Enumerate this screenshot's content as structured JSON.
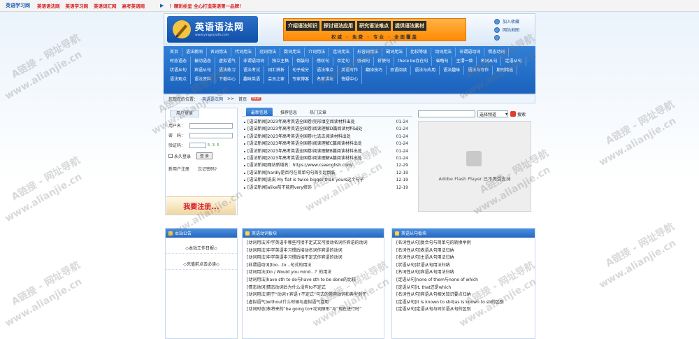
{
  "topbar": {
    "net": "英语学习网",
    "links": [
      "英语语法网",
      "英语学习网",
      "英语词汇网",
      "高考英语网"
    ],
    "promo": "！精彩纷呈 全心打造英语第一品牌！"
  },
  "header": {
    "logo_title": "英语语法网",
    "logo_sub": "www.yingyuyufa.com",
    "banner_tags": [
      "介绍语法知识",
      "探讨语法应用",
      "研究语法难点",
      "提供语法素材"
    ],
    "banner_sub": "权威 · 免费 · 专业 · 全面覆盖",
    "links": [
      "加入收藏",
      "网站地图"
    ]
  },
  "nav": {
    "items": [
      "首页",
      "语法新闻",
      "名词用法",
      "代词用法",
      "冠词用法",
      "数词用法",
      "介词用法",
      "连词用法",
      "形容词用法",
      "副词用法",
      "比较等级",
      "动词用法",
      "非谓语动词",
      "情态动词",
      "时态语态",
      "被动语态",
      "虚拟语气",
      "非谓语动词",
      "独立主格",
      "倒装句",
      "感叹句",
      "否定句",
      "强调句",
      "祈使句",
      "there be存在句",
      "省略句",
      "主谓一致",
      "名词从句",
      "定语从句",
      "状语从句",
      "宾语从句",
      "语法练习",
      "语法考试",
      "词汇辨析",
      "句子成分",
      "语法难点",
      "英语写作",
      "翻译技巧",
      "双语阅读",
      "语法与应用",
      "语法趣味",
      "语法与写作",
      "期刊精选",
      "语法观点",
      "语法资料",
      "下载中心",
      "趣味英语",
      "会员之家",
      "专家博客",
      "名家讲坛",
      "答疑中心"
    ]
  },
  "crumb": {
    "label": "您现在的位置：",
    "home": "英语语法网",
    "sep": ">>",
    "page": "首页",
    "badge": "NEW"
  },
  "login": {
    "tab": "用户登录",
    "user": "用户名：",
    "pass": "密　码：",
    "vcode": "验证码：",
    "vimg": "5 3 5",
    "remember": "永久登录",
    "submit": "登 录",
    "register": "新用户注册",
    "forgot": "忘记密码?",
    "reg_img": "我要注册..."
  },
  "news": {
    "tabs": [
      "最新信息",
      "推荐信息",
      "热门文章"
    ],
    "items": [
      {
        "t": "[语法新闻]2023年高考英语全国卷Ⅰ完形填空阅读材料出处",
        "d": "01-24"
      },
      {
        "t": "[语法新闻]2023年高考英语全国卷Ⅰ阅读理解D篇阅读材料出处",
        "d": "01-24"
      },
      {
        "t": "[语法新闻]2023年高考英语全国卷Ⅰ七选五阅读材料出处",
        "d": "01-24"
      },
      {
        "t": "[语法新闻]2023年高考英语全国卷Ⅰ阅读理解C篇阅读材料出处",
        "d": "01-24"
      },
      {
        "t": "[语法新闻]2023年高考英语全国卷Ⅰ阅读理解B篇阅读材料出处",
        "d": "01-24"
      },
      {
        "t": "[语法新闻]2023年高考英语全国卷Ⅰ阅读理解A篇阅读材料出处",
        "d": "01-24"
      },
      {
        "t": "[语法新闻]网站新域名：https://www.cseenglish.com/",
        "d": "12-29"
      },
      {
        "t": "[语法新闻]hardly是否可在简单句句首引起倒装",
        "d": "12-19"
      },
      {
        "t": "[语法新闻]说说 My flat is twice bigger than yours这个句子",
        "d": "12-19"
      },
      {
        "t": "[语法新闻]alike前不能用very修饰",
        "d": "12-19"
      }
    ]
  },
  "search": {
    "select": "选择频道",
    "button": "搜索"
  },
  "flash": {
    "msg": "Adobe Flash Player 已不再受支持"
  },
  "notice": {
    "title": "本站公告",
    "items": [
      "◇本站工作日报◇",
      "◇充值前点击必读◇"
    ]
  },
  "panel2": {
    "title": "英语动词板块",
    "items": [
      "[动词用法]中学英语中哪些可接不定式又可接动名词作宾语的动词",
      "[动词用法]中学英语中习惯后接动名词作宾语的动词",
      "[动词用法]中学英语中习惯后接不定式作宾语的动词",
      "[非谓语动词]too…to…句式的用法",
      "[动词用法]Do / Would you mind…？的用法",
      "[动词用法]have sth to do与have sth to be done的比较",
      "[情态动词]情态动词后为什么没有to不定式",
      "[动词用法]用于“动词+宾语+不定式”句式的常用动词和典型例子",
      "[虚拟语气]without什么时候与虚拟语气连用",
      "[动词时态]表将来的“be going to+动词原形”与“现在进行时”"
    ]
  },
  "panel3": {
    "title": "英语从句板块",
    "items": [
      "[名词性从句]复合句与简单句的转换举例",
      "[名词性从句]表语从句用法归纳",
      "[名词性从句]主语从句用法归纳",
      "[状语从句]状语从句用法归纳",
      "[名词性从句]宾语从句用法归纳",
      "[定语从句]none of them与none of which",
      "[定语从句]it, that还是which",
      "[名词性从句]宾语从句相关知识要点归纳",
      "[定语从句]it is known to sb与as is known to sb的区别",
      "[定语从句]定语从句与同位语从句的区别"
    ]
  },
  "watermark": {
    "a": "A链接 - 网址导航",
    "b": "www.alianjie.cn"
  }
}
